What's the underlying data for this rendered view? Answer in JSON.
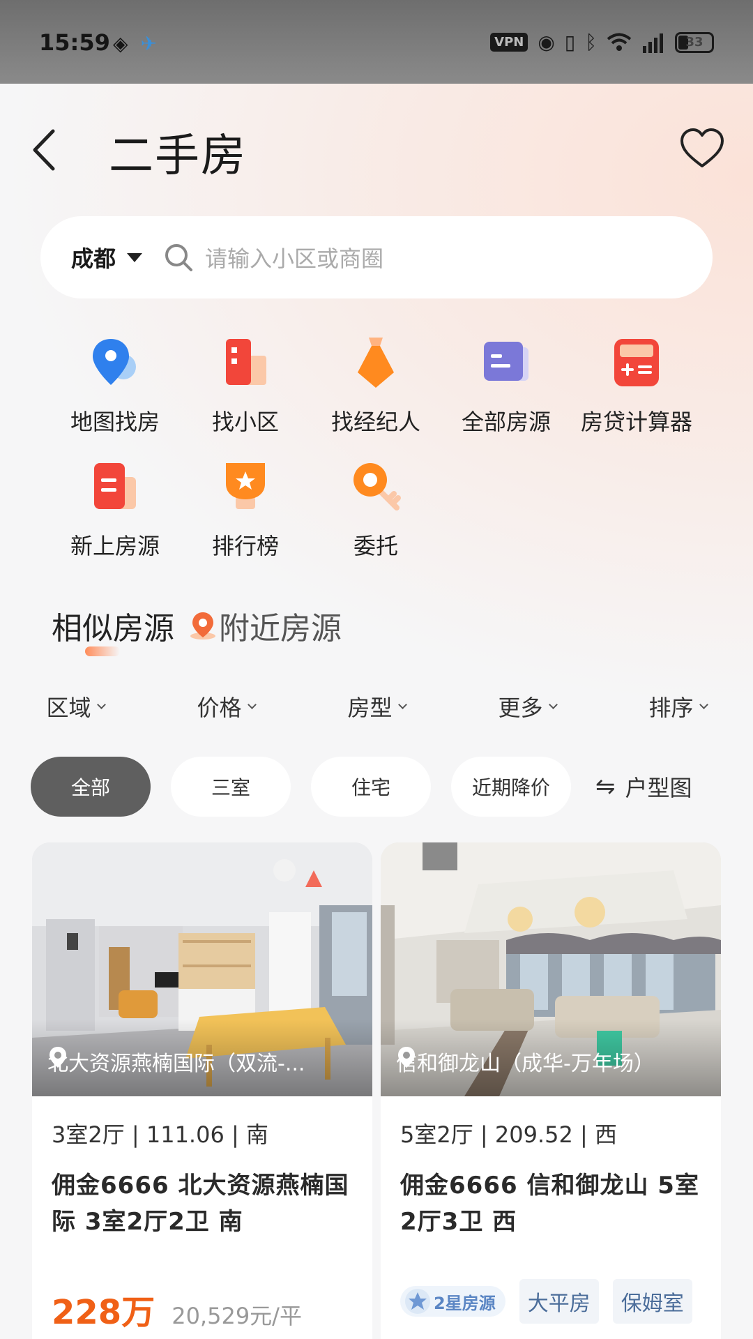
{
  "status_bar": {
    "time": "15:59",
    "vpn": "VPN",
    "battery": "33"
  },
  "header": {
    "title": "二手房"
  },
  "search": {
    "city": "成都",
    "placeholder": "请输入小区或商圈"
  },
  "quick_entries": [
    {
      "label": "地图找房",
      "icon": "map-pin-icon"
    },
    {
      "label": "找小区",
      "icon": "building-icon"
    },
    {
      "label": "找经纪人",
      "icon": "agent-tie-icon"
    },
    {
      "label": "全部房源",
      "icon": "listing-icon"
    },
    {
      "label": "房贷计算器",
      "icon": "calculator-icon"
    },
    {
      "label": "新上房源",
      "icon": "new-listing-icon"
    },
    {
      "label": "排行榜",
      "icon": "trophy-icon"
    },
    {
      "label": "委托",
      "icon": "key-icon"
    }
  ],
  "section_tabs": {
    "similar": "相似房源",
    "nearby": "附近房源"
  },
  "filters": [
    "区域",
    "价格",
    "房型",
    "更多",
    "排序"
  ],
  "chips": [
    "全部",
    "三室",
    "住宅",
    "近期降价"
  ],
  "floor_plan_label": "户型图",
  "listings": [
    {
      "location": "北大资源燕楠国际（双流-...",
      "specs": "3室2厅 | 111.06 | 南",
      "title": "佣金6666 北大资源燕楠国际 3室2厅2卫 南",
      "price": "228万",
      "unit_price": "20,529元/平"
    },
    {
      "location": "信和御龙山（成华-万年场）",
      "specs": "5室2厅 | 209.52 | 西",
      "title": "佣金6666 信和御龙山 5室2厅3卫 西",
      "star_tag": "2星房源",
      "tags": [
        "大平房",
        "保姆室"
      ]
    }
  ],
  "colors": {
    "accent_price": "#f06016",
    "chip_active": "#5f5f5f",
    "tag_text": "#4b6d9a"
  }
}
